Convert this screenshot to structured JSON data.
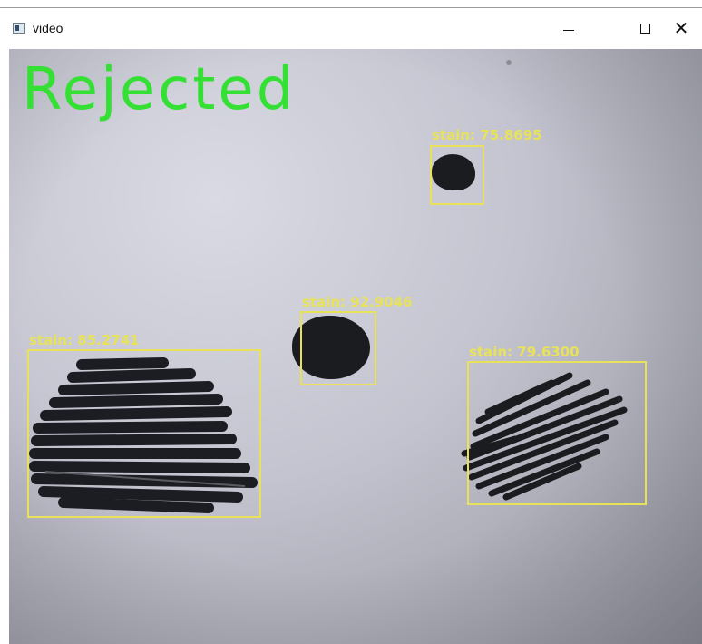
{
  "window": {
    "title": "video",
    "minimize_glyph": "–",
    "maximize_glyph": "☐",
    "close_glyph": "✕"
  },
  "video": {
    "status_text": "Rejected",
    "status_color": "#33e033",
    "box_color": "#e8e25a",
    "detections": [
      {
        "label": "stain: 75.8695"
      },
      {
        "label": "stain: 92.9046"
      },
      {
        "label": "stain: 85.2741"
      },
      {
        "label": "stain: 79.6300"
      }
    ]
  }
}
